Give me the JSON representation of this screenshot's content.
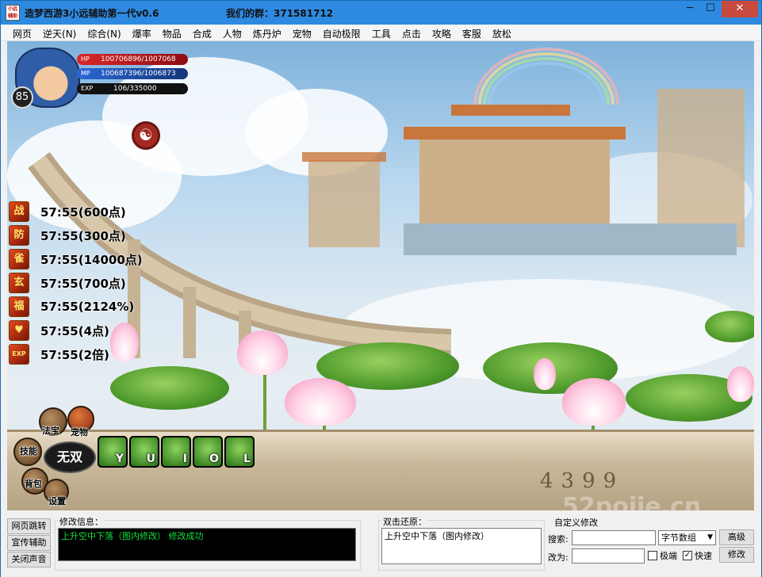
{
  "window": {
    "app_icon_text": "小远辅助",
    "title": "造梦西游3小远辅助第一代v0.6",
    "group_text": "我们的群：371581712",
    "controls": {
      "minimize": "─",
      "maximize": "☐",
      "close": "✕"
    }
  },
  "menu": [
    "网页",
    "逆天(N)",
    "综合(N)",
    "爆率",
    "物品",
    "合成",
    "人物",
    "炼丹炉",
    "宠物",
    "自动极限",
    "工具",
    "点击",
    "攻略",
    "客服",
    "放松"
  ],
  "hud": {
    "level": "85",
    "hp": {
      "label": "HP",
      "value": "100706896/1007068"
    },
    "mp": {
      "label": "MP",
      "value": "100687396/1006873"
    },
    "exp": {
      "label": "EXP",
      "value": "106/335000"
    },
    "taiji_icon": "☯"
  },
  "buffs": [
    {
      "icon": "战",
      "text": "57:55(600点)"
    },
    {
      "icon": "防",
      "text": "57:55(300点)"
    },
    {
      "icon": "雀",
      "text": "57:55(14000点)"
    },
    {
      "icon": "玄",
      "text": "57:55(700点)"
    },
    {
      "icon": "福",
      "text": "57:55(2124%)"
    },
    {
      "icon": "♥",
      "text": "57:55(4点)"
    },
    {
      "icon": "EXP",
      "text": "57:55(2倍)"
    }
  ],
  "skills": {
    "fabao": "法宝",
    "pet": "宠物",
    "skill": "技能",
    "bag": "背包",
    "settings": "设置",
    "wushuang": "无双",
    "hotkeys": [
      "Y",
      "U",
      "I",
      "O",
      "L"
    ]
  },
  "ground_number": "4399",
  "watermark": "52pojie.cn",
  "panel": {
    "side_buttons": [
      "网页跳转",
      "宣传辅助",
      "关闭声音"
    ],
    "modify_info_label": "修改信息：",
    "modify_log": "上升空中下落（图内修改）  修改成功",
    "restore_label": "双击还原：",
    "restore_text": "上升空中下落（图内修改）",
    "custom_label": "自定义修改",
    "search_label": "搜索:",
    "change_label": "改为:",
    "search_value": "",
    "change_value": "",
    "type_select": "字节数组",
    "advanced_button": "高级",
    "modify_button": "修改",
    "checkbox_extreme": {
      "label": "极端",
      "checked": false
    },
    "checkbox_fast": {
      "label": "快速",
      "checked": true
    }
  }
}
